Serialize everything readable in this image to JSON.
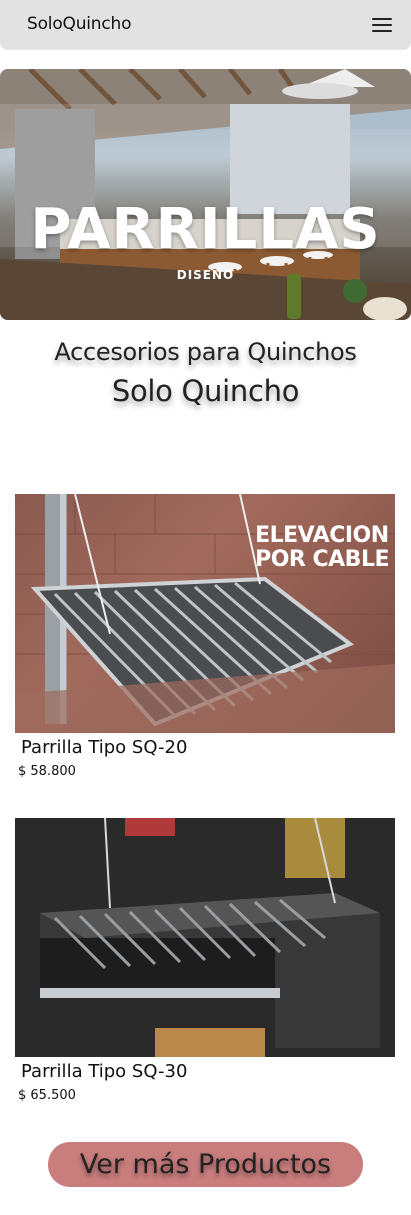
{
  "navbar": {
    "brand": "SoloQuincho",
    "menu_icon": "hamburger-menu-icon"
  },
  "hero": {
    "title": "PARRILLAS",
    "subtitle": "DISEÑO"
  },
  "headings": {
    "line1": "Accesorios para Quinchos",
    "line2": "Solo Quincho"
  },
  "products": [
    {
      "name": "Parrilla Tipo SQ-20",
      "price": "$ 58.800",
      "image_overlay": "ELEVACION\nPOR CABLE"
    },
    {
      "name": "Parrilla Tipo SQ-30",
      "price": "$ 65.500"
    }
  ],
  "cta": {
    "label": "Ver más Productos"
  },
  "colors": {
    "navbar_bg": "#e2e2e2",
    "cta_bg": "#c97d7d"
  }
}
